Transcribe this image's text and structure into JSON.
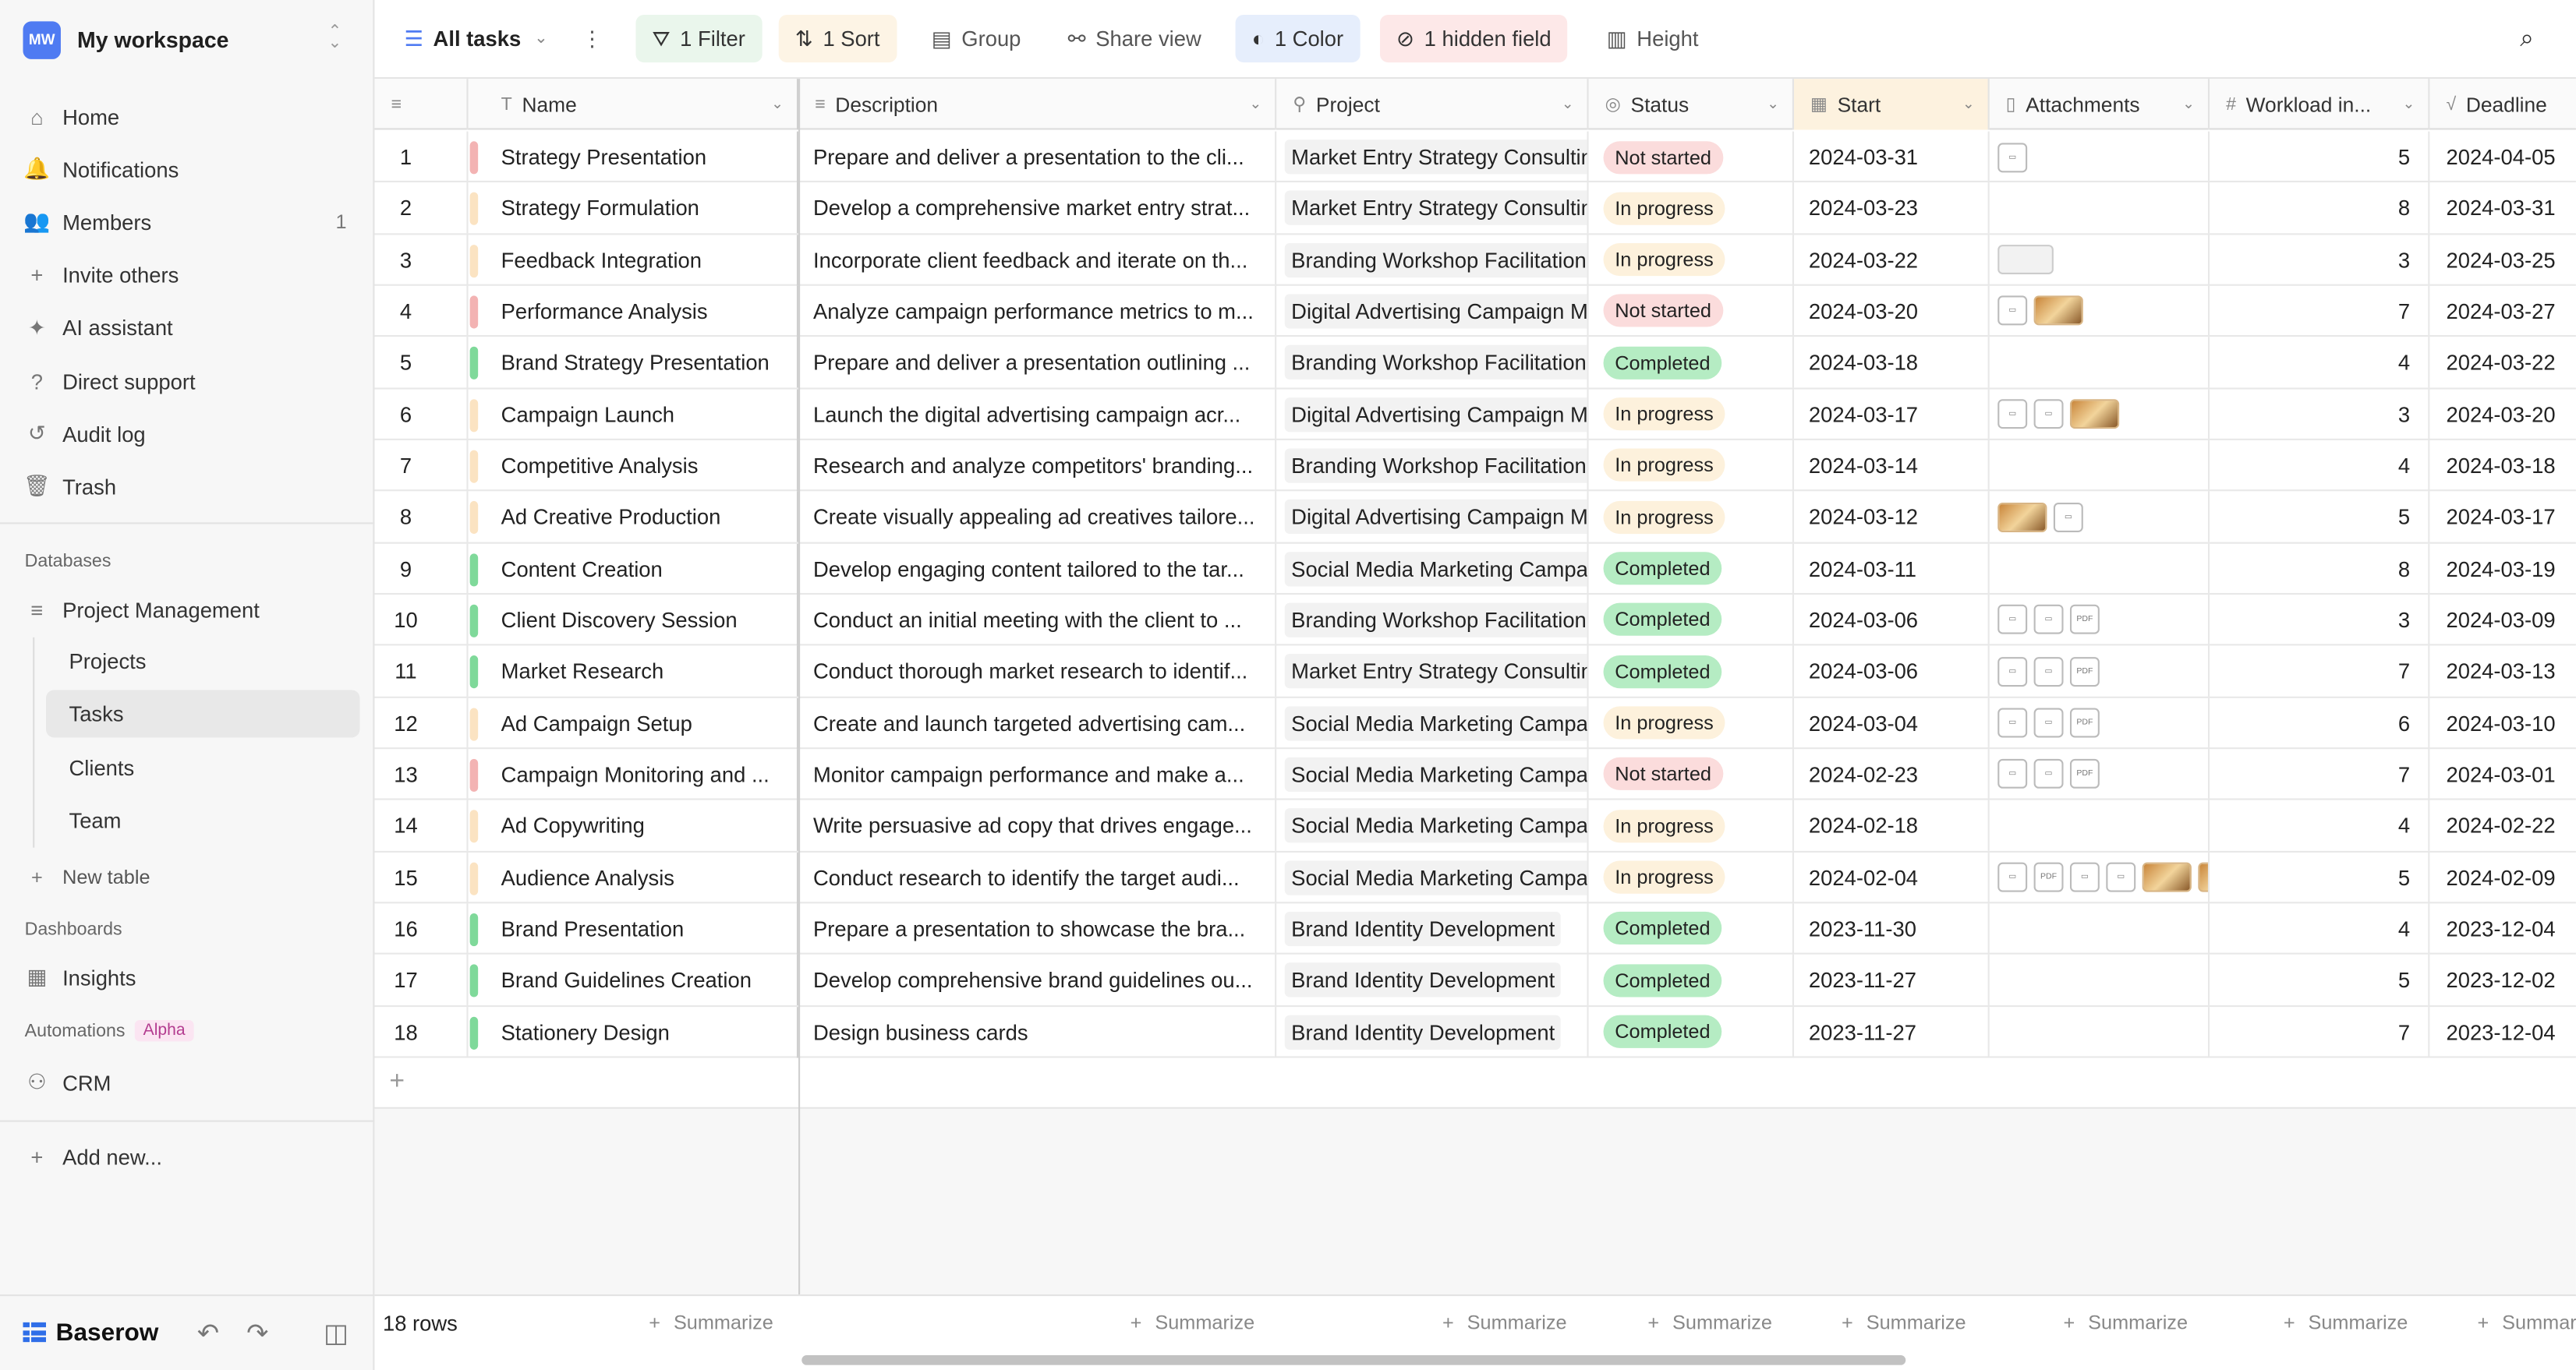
{
  "workspace": {
    "badge": "MW",
    "name": "My workspace"
  },
  "nav": [
    {
      "label": "Home",
      "icon": "home-icon",
      "glyph": "⌂"
    },
    {
      "label": "Notifications",
      "icon": "bell-icon",
      "glyph": "🔔"
    },
    {
      "label": "Members",
      "icon": "members-icon",
      "glyph": "👥",
      "count": "1"
    },
    {
      "label": "Invite others",
      "icon": "invite-icon",
      "glyph": "+"
    },
    {
      "label": "AI assistant",
      "icon": "ai-icon",
      "glyph": "✦"
    },
    {
      "label": "Direct support",
      "icon": "help-icon",
      "glyph": "?"
    },
    {
      "label": "Audit log",
      "icon": "history-icon",
      "glyph": "↺"
    },
    {
      "label": "Trash",
      "icon": "trash-icon",
      "glyph": "🗑"
    }
  ],
  "sections": {
    "databases": "Databases",
    "dashboards": "Dashboards",
    "automations": "Automations",
    "alpha": "Alpha"
  },
  "database": {
    "name": "Project Management",
    "tables": [
      "Projects",
      "Tasks",
      "Clients",
      "Team"
    ],
    "active": "Tasks"
  },
  "new_table": "New table",
  "dashboard": "Insights",
  "automation": "CRM",
  "add_new": "Add new...",
  "brand": "Baserow",
  "toolbar": {
    "view": "All tasks",
    "filter": "1 Filter",
    "sort": "1 Sort",
    "group": "Group",
    "share": "Share view",
    "color": "1 Color",
    "hidden": "1 hidden field",
    "height": "Height"
  },
  "columns": [
    "Name",
    "Description",
    "Project",
    "Status",
    "Start",
    "Attachments",
    "Workload in...",
    "Deadline"
  ],
  "colors": {
    "not_started": "#f3b3b3",
    "in_progress": "#fbe3c2",
    "completed": "#7fd99a"
  },
  "rows": [
    {
      "n": "1",
      "name": "Strategy Presentation",
      "desc": "Prepare and deliver a presentation to the cli...",
      "project": "Market Entry Strategy Consulting",
      "status": "Not started",
      "start": "2024-03-31",
      "att": [
        "doc"
      ],
      "work": "5",
      "deadline": "2024-04-05"
    },
    {
      "n": "2",
      "name": "Strategy Formulation",
      "desc": "Develop a comprehensive market entry strat...",
      "project": "Market Entry Strategy Consulting",
      "status": "In progress",
      "start": "2024-03-23",
      "att": [],
      "work": "8",
      "deadline": "2024-03-31"
    },
    {
      "n": "3",
      "name": "Feedback Integration",
      "desc": "Incorporate client feedback and iterate on th...",
      "project": "Branding Workshop Facilitation",
      "status": "In progress",
      "start": "2024-03-22",
      "att": [
        "blank"
      ],
      "work": "3",
      "deadline": "2024-03-25"
    },
    {
      "n": "4",
      "name": "Performance Analysis",
      "desc": "Analyze campaign performance metrics to m...",
      "project": "Digital Advertising Campaign Management",
      "status": "Not started",
      "start": "2024-03-20",
      "att": [
        "doc",
        "img"
      ],
      "work": "7",
      "deadline": "2024-03-27"
    },
    {
      "n": "5",
      "name": "Brand Strategy Presentation",
      "desc": "Prepare and deliver a presentation outlining ...",
      "project": "Branding Workshop Facilitation",
      "status": "Completed",
      "start": "2024-03-18",
      "att": [],
      "work": "4",
      "deadline": "2024-03-22"
    },
    {
      "n": "6",
      "name": "Campaign Launch",
      "desc": "Launch the digital advertising campaign acr...",
      "project": "Digital Advertising Campaign Management",
      "status": "In progress",
      "start": "2024-03-17",
      "att": [
        "doc",
        "doc",
        "img"
      ],
      "work": "3",
      "deadline": "2024-03-20"
    },
    {
      "n": "7",
      "name": "Competitive Analysis",
      "desc": "Research and analyze competitors' branding...",
      "project": "Branding Workshop Facilitation",
      "status": "In progress",
      "start": "2024-03-14",
      "att": [],
      "work": "4",
      "deadline": "2024-03-18"
    },
    {
      "n": "8",
      "name": "Ad Creative Production",
      "desc": "Create visually appealing ad creatives tailore...",
      "project": "Digital Advertising Campaign Management",
      "status": "In progress",
      "start": "2024-03-12",
      "att": [
        "img",
        "doc"
      ],
      "work": "5",
      "deadline": "2024-03-17"
    },
    {
      "n": "9",
      "name": "Content Creation",
      "desc": "Develop engaging content tailored to the tar...",
      "project": "Social Media Marketing Campaign",
      "status": "Completed",
      "start": "2024-03-11",
      "att": [],
      "work": "8",
      "deadline": "2024-03-19"
    },
    {
      "n": "10",
      "name": "Client Discovery Session",
      "desc": "Conduct an initial meeting with the client to ...",
      "project": "Branding Workshop Facilitation",
      "status": "Completed",
      "start": "2024-03-06",
      "att": [
        "doc",
        "doc",
        "pdf"
      ],
      "work": "3",
      "deadline": "2024-03-09"
    },
    {
      "n": "11",
      "name": "Market Research",
      "desc": "Conduct thorough market research to identif...",
      "project": "Market Entry Strategy Consulting",
      "status": "Completed",
      "start": "2024-03-06",
      "att": [
        "doc",
        "doc",
        "pdf"
      ],
      "work": "7",
      "deadline": "2024-03-13"
    },
    {
      "n": "12",
      "name": "Ad Campaign Setup",
      "desc": "Create and launch targeted advertising cam...",
      "project": "Social Media Marketing Campaign",
      "status": "In progress",
      "start": "2024-03-04",
      "att": [
        "doc",
        "doc",
        "pdf"
      ],
      "work": "6",
      "deadline": "2024-03-10"
    },
    {
      "n": "13",
      "name": "Campaign Monitoring and ...",
      "desc": "Monitor campaign performance and make a...",
      "project": "Social Media Marketing Campaign",
      "status": "Not started",
      "start": "2024-02-23",
      "att": [
        "doc",
        "doc",
        "pdf"
      ],
      "work": "7",
      "deadline": "2024-03-01"
    },
    {
      "n": "14",
      "name": "Ad Copywriting",
      "desc": "Write persuasive ad copy that drives engage...",
      "project": "Social Media Marketing Campaign",
      "status": "In progress",
      "start": "2024-02-18",
      "att": [],
      "work": "4",
      "deadline": "2024-02-22"
    },
    {
      "n": "15",
      "name": "Audience Analysis",
      "desc": "Conduct research to identify the target audi...",
      "project": "Social Media Marketing Campaign",
      "status": "In progress",
      "start": "2024-02-04",
      "att": [
        "doc",
        "pdf",
        "doc",
        "doc",
        "img",
        "img"
      ],
      "work": "5",
      "deadline": "2024-02-09"
    },
    {
      "n": "16",
      "name": "Brand Presentation",
      "desc": "Prepare a presentation to showcase the bra...",
      "project": "Brand Identity Development",
      "status": "Completed",
      "start": "2023-11-30",
      "att": [],
      "work": "4",
      "deadline": "2023-12-04"
    },
    {
      "n": "17",
      "name": "Brand Guidelines Creation",
      "desc": "Develop comprehensive brand guidelines ou...",
      "project": "Brand Identity Development",
      "status": "Completed",
      "start": "2023-11-27",
      "att": [],
      "work": "5",
      "deadline": "2023-12-02"
    },
    {
      "n": "18",
      "name": "Stationery Design",
      "desc": "Design business cards",
      "project": "Brand Identity Development",
      "status": "Completed",
      "start": "2023-11-27",
      "att": [],
      "work": "7",
      "deadline": "2023-12-04"
    }
  ],
  "footer": {
    "rows": "18 rows",
    "summarize": "Summarize"
  }
}
